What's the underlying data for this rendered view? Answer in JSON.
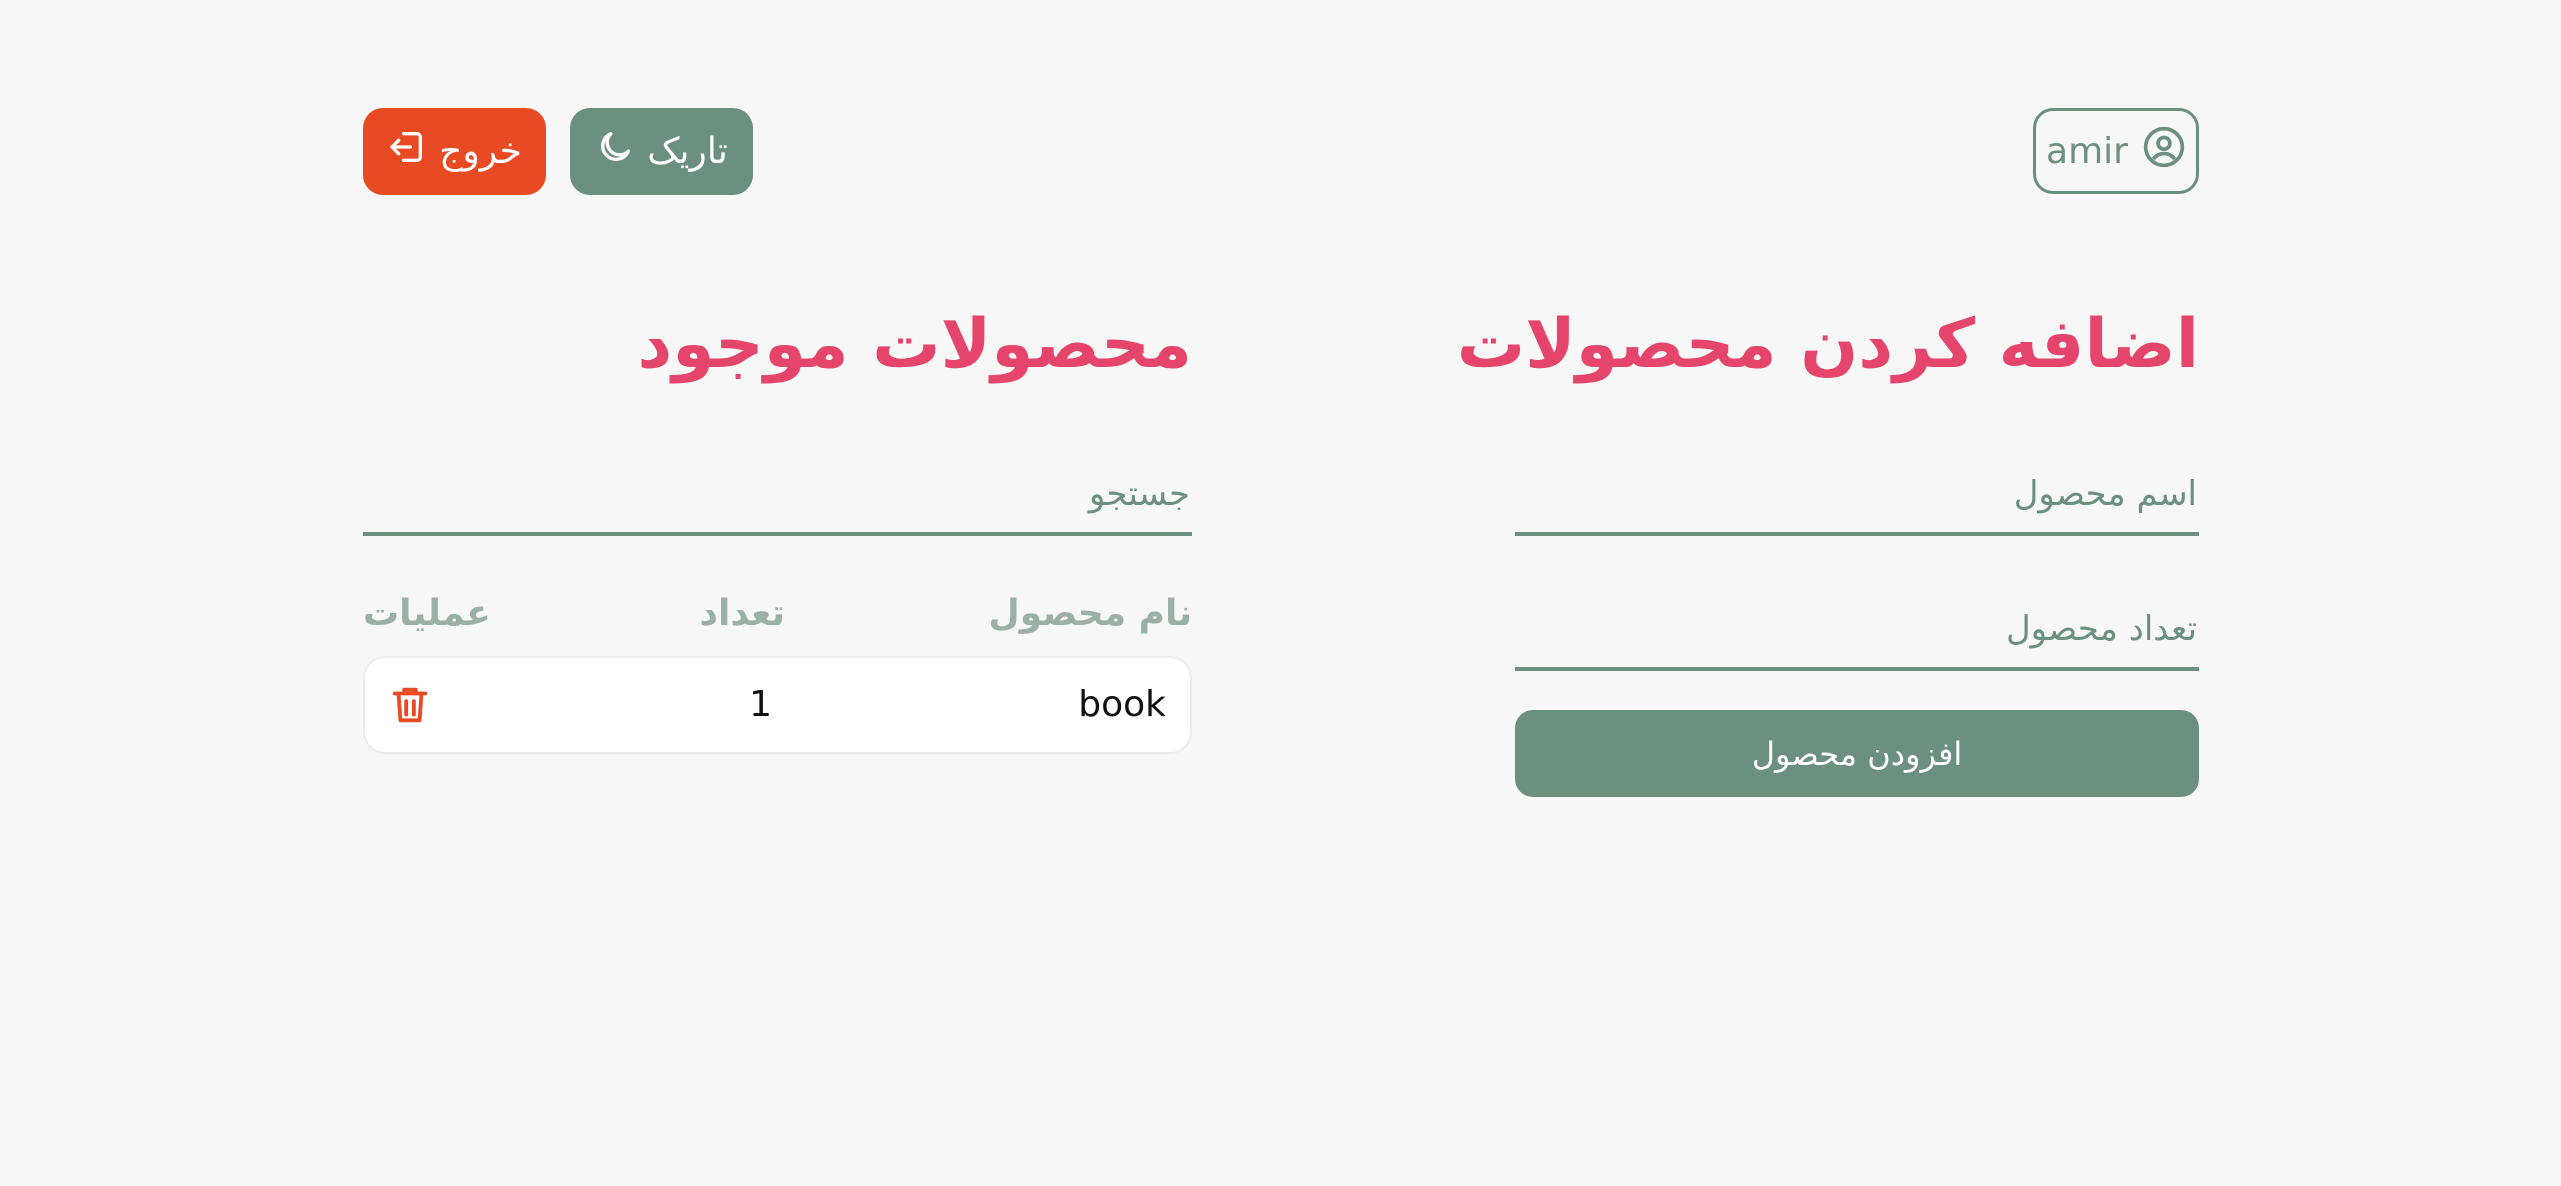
{
  "header": {
    "username": "amir",
    "logout_label": "خروج",
    "theme_label": "تاریک"
  },
  "add_section": {
    "title": "اضافه کردن محصولات",
    "name_placeholder": "اسم محصول",
    "count_placeholder": "تعداد محصول",
    "add_button_label": "افزودن محصول"
  },
  "list_section": {
    "title": "محصولات موجود",
    "search_placeholder": "جستجو",
    "columns": [
      "نام محصول",
      "تعداد",
      "عملیات"
    ],
    "rows": [
      {
        "name": "book",
        "count": "1"
      }
    ]
  },
  "colors": {
    "accent": "#6b9080",
    "title": "#e5456a",
    "danger": "#e84b23",
    "background": "#f7f7f7"
  },
  "icons": {
    "user": "user-circle-icon",
    "theme": "moon-icon",
    "logout": "logout-icon",
    "delete": "trash-icon"
  }
}
